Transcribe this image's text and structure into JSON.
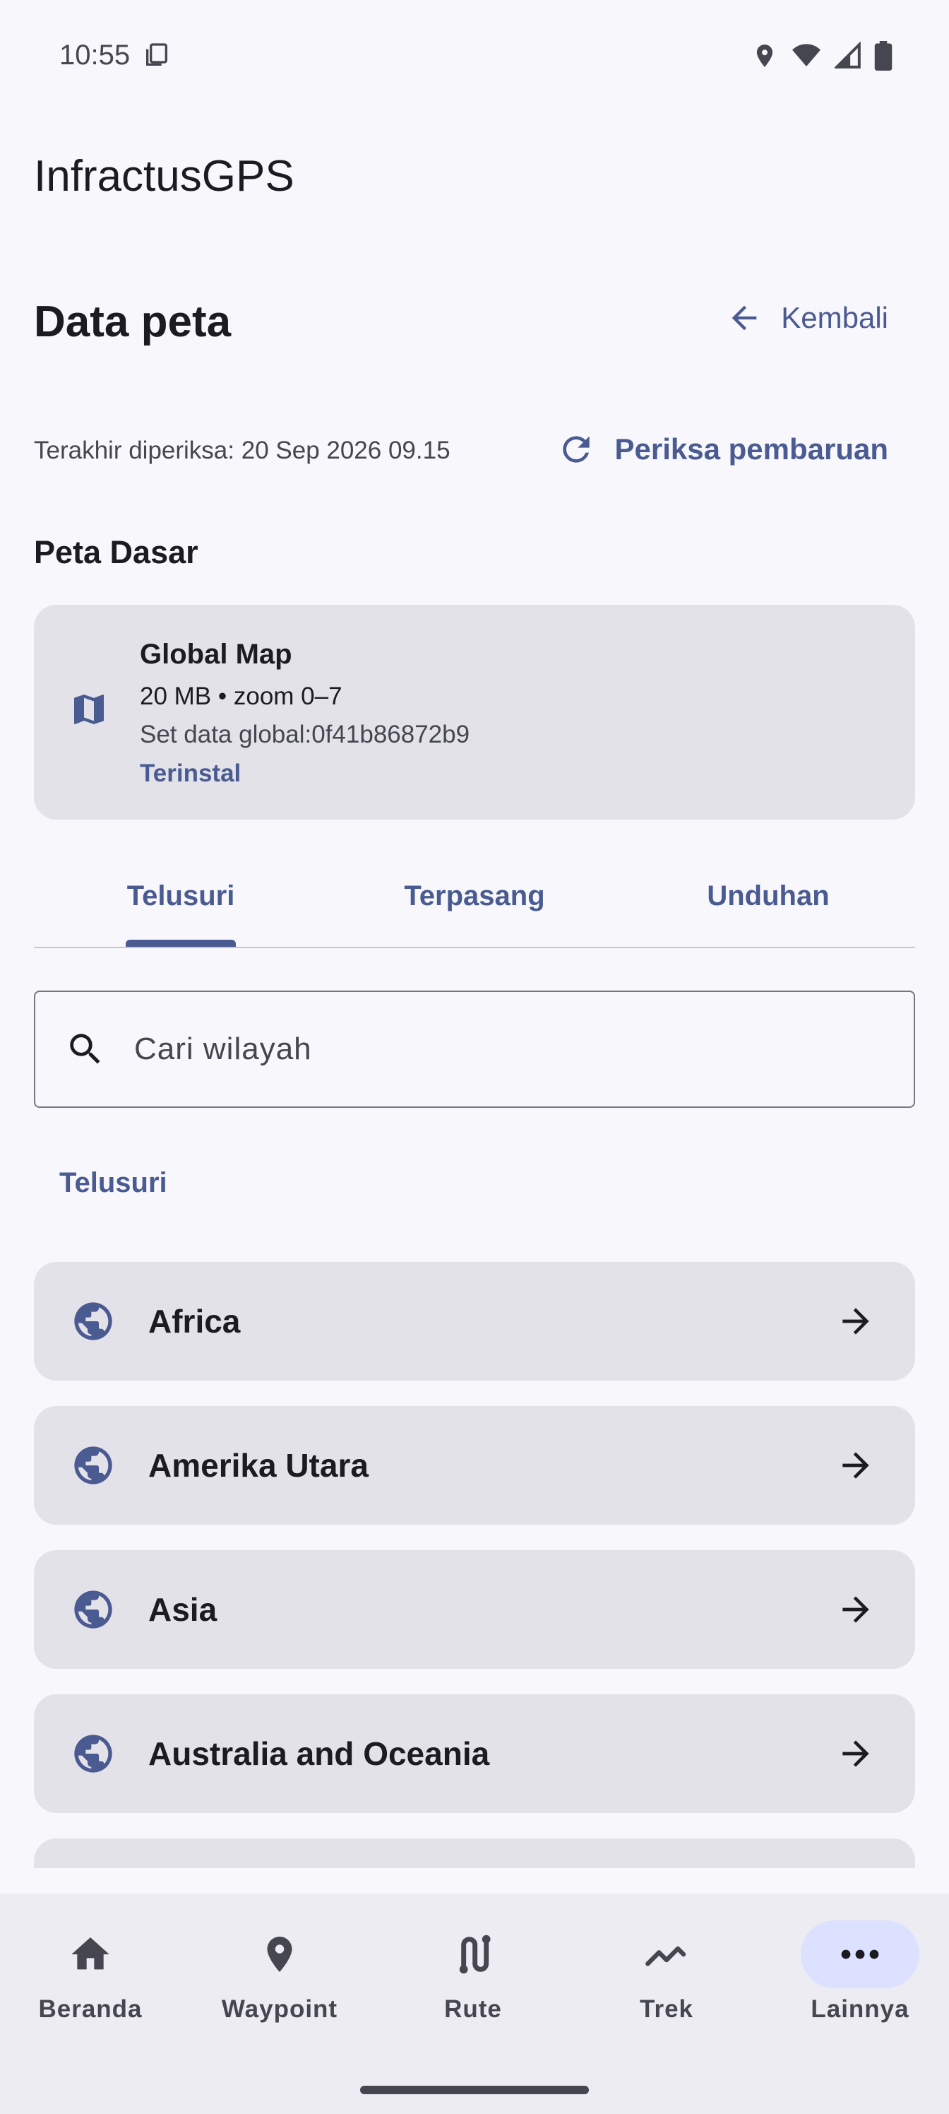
{
  "status_bar": {
    "time": "10:55"
  },
  "app": {
    "title": "InfractusGPS"
  },
  "header": {
    "title": "Data peta",
    "back_label": "Kembali"
  },
  "update": {
    "last_checked": "Terakhir diperiksa: 20 Sep 2026 09.15",
    "check_label": "Periksa pembaruan"
  },
  "base_section": {
    "title": "Peta Dasar",
    "card": {
      "name": "Global Map",
      "meta": "20 MB • zoom 0–7",
      "dataset": "Set data global:0f41b86872b9",
      "status": "Terinstal"
    }
  },
  "tabs": [
    {
      "label": "Telusuri",
      "selected": true
    },
    {
      "label": "Terpasang",
      "selected": false
    },
    {
      "label": "Unduhan",
      "selected": false
    }
  ],
  "search": {
    "placeholder": "Cari wilayah",
    "value": ""
  },
  "browse_label": "Telusuri",
  "regions": [
    {
      "label": "Africa"
    },
    {
      "label": "Amerika Utara"
    },
    {
      "label": "Asia"
    },
    {
      "label": "Australia and Oceania"
    }
  ],
  "nav": [
    {
      "label": "Beranda",
      "icon": "home-icon"
    },
    {
      "label": "Waypoint",
      "icon": "pin-icon"
    },
    {
      "label": "Rute",
      "icon": "route-icon"
    },
    {
      "label": "Trek",
      "icon": "track-icon"
    },
    {
      "label": "Lainnya",
      "icon": "more-icon",
      "selected": true
    }
  ],
  "colors": {
    "accent": "#4a5b92",
    "surface": "#e2e2e8",
    "background": "#f7f7fc",
    "nav_selected": "#dce1ff"
  }
}
